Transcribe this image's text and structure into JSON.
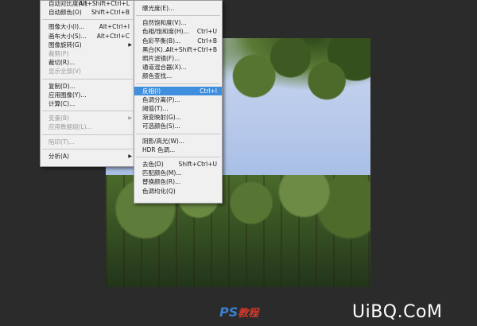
{
  "left_menu": {
    "items": [
      {
        "label": "自动对比度(U)",
        "shortcut": "Alt+Shift+Ctrl+L",
        "disabled": false
      },
      {
        "label": "自动颜色(O)",
        "shortcut": "Shift+Ctrl+B",
        "disabled": false
      },
      {
        "separator": true
      },
      {
        "label": "图像大小(I)...",
        "shortcut": "Alt+Ctrl+I",
        "disabled": false
      },
      {
        "label": "画布大小(S)...",
        "shortcut": "Alt+Ctrl+C",
        "disabled": false
      },
      {
        "label": "图像旋转(G)",
        "shortcut": "",
        "disabled": false,
        "submenu": true
      },
      {
        "label": "裁剪(P)",
        "shortcut": "",
        "disabled": true
      },
      {
        "label": "裁切(R)...",
        "shortcut": "",
        "disabled": false
      },
      {
        "label": "显示全部(V)",
        "shortcut": "",
        "disabled": true
      },
      {
        "separator": true
      },
      {
        "label": "复制(D)...",
        "shortcut": "",
        "disabled": false
      },
      {
        "label": "应用图像(Y)...",
        "shortcut": "",
        "disabled": false
      },
      {
        "label": "计算(C)...",
        "shortcut": "",
        "disabled": false
      },
      {
        "separator": true
      },
      {
        "label": "变量(B)",
        "shortcut": "",
        "disabled": true,
        "submenu": true
      },
      {
        "label": "应用数据组(L)...",
        "shortcut": "",
        "disabled": true
      },
      {
        "separator": true
      },
      {
        "label": "陷印(T)...",
        "shortcut": "",
        "disabled": true
      },
      {
        "separator": true
      },
      {
        "label": "分析(A)",
        "shortcut": "",
        "disabled": false,
        "submenu": true
      }
    ]
  },
  "right_menu": {
    "items": [
      {
        "label": "曝光度(E)...",
        "shortcut": ""
      },
      {
        "separator": true
      },
      {
        "label": "自然饱和度(V)...",
        "shortcut": ""
      },
      {
        "label": "色相/饱和度(H)...",
        "shortcut": "Ctrl+U"
      },
      {
        "label": "色彩平衡(B)...",
        "shortcut": "Ctrl+B"
      },
      {
        "label": "黑白(K)...",
        "shortcut": "Alt+Shift+Ctrl+B"
      },
      {
        "label": "照片滤镜(F)...",
        "shortcut": ""
      },
      {
        "label": "通道混合器(X)...",
        "shortcut": ""
      },
      {
        "label": "颜色查找...",
        "shortcut": ""
      },
      {
        "separator": true
      },
      {
        "label": "反相(I)",
        "shortcut": "Ctrl+I",
        "highlighted": true
      },
      {
        "label": "色调分离(P)...",
        "shortcut": ""
      },
      {
        "label": "阈值(T)...",
        "shortcut": ""
      },
      {
        "label": "渐变映射(G)...",
        "shortcut": ""
      },
      {
        "label": "可选颜色(S)...",
        "shortcut": ""
      },
      {
        "separator": true
      },
      {
        "label": "阴影/高光(W)...",
        "shortcut": ""
      },
      {
        "label": "HDR 色调...",
        "shortcut": ""
      },
      {
        "separator": true
      },
      {
        "label": "去色(D)",
        "shortcut": "Shift+Ctrl+U"
      },
      {
        "label": "匹配颜色(M)...",
        "shortcut": ""
      },
      {
        "label": "替换颜色(R)...",
        "shortcut": ""
      },
      {
        "label": "色调均化(Q)",
        "shortcut": ""
      }
    ]
  },
  "watermark": {
    "ps": "PS",
    "ps2": "教程",
    "site": "UiBQ.CoM"
  },
  "colors": {
    "highlight": "#3f8fde",
    "background": "#2b2b2b",
    "menu": "#f0f0f0"
  }
}
